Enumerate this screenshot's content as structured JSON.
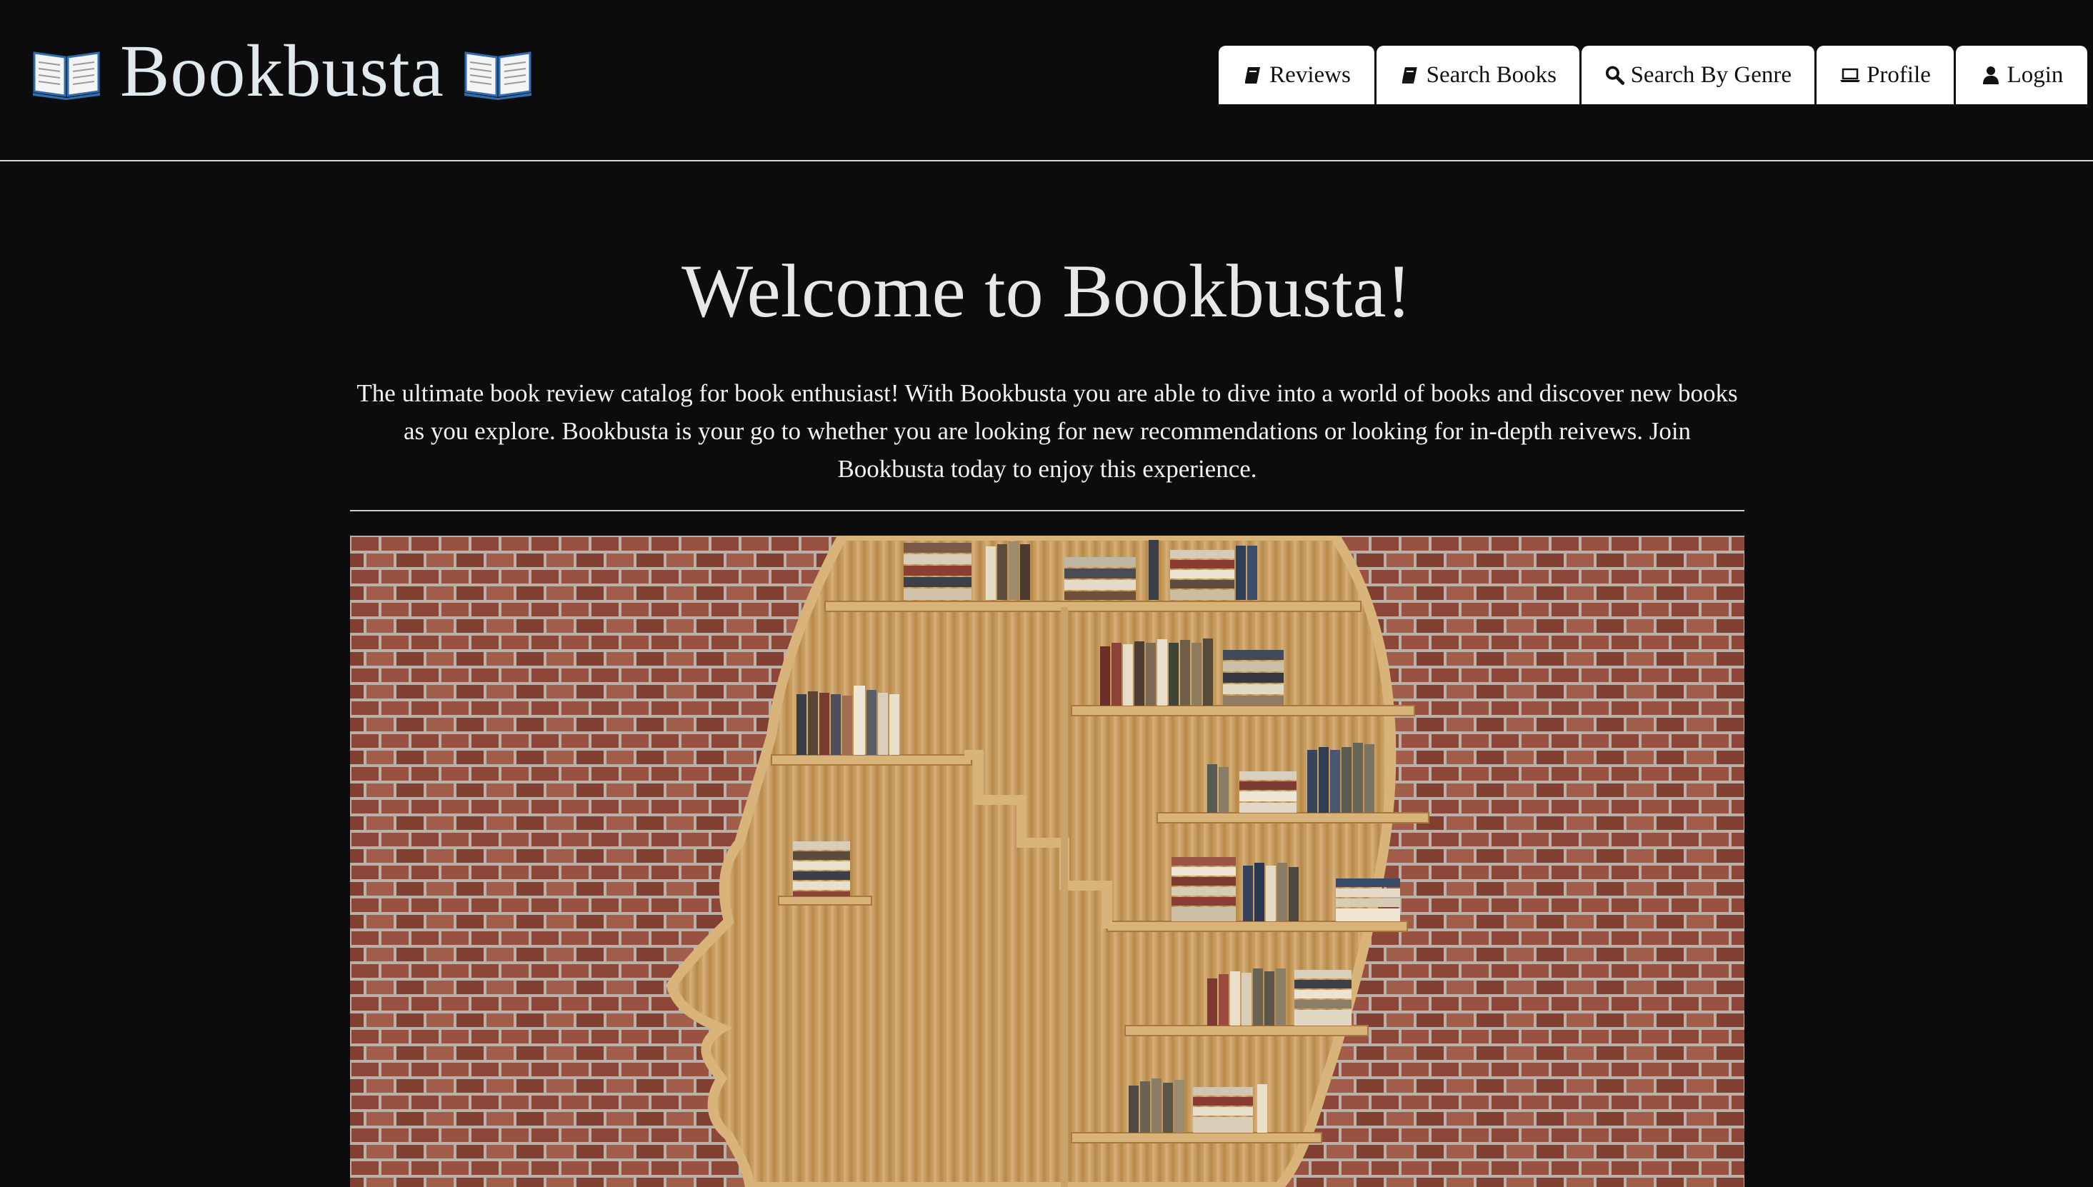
{
  "header": {
    "brand_title": "Bookbusta",
    "brand_icon": "open-book-emoji"
  },
  "nav": {
    "items": [
      {
        "label": "Reviews",
        "icon": "book-icon"
      },
      {
        "label": "Search Books",
        "icon": "book-icon"
      },
      {
        "label": "Search By Genre",
        "icon": "search-icon"
      },
      {
        "label": "Profile",
        "icon": "laptop-icon"
      },
      {
        "label": "Login",
        "icon": "user-icon"
      }
    ]
  },
  "main": {
    "heading": "Welcome to Bookbusta!",
    "intro_lines": [
      "The ultimate book review catalog for book enthusiast! With Bookbusta you are able to dive into a world of books and discover new books",
      "as you explore. Bookbusta is your go to whether you are looking for new recommendations or looking for in-depth reivews. Join",
      "Bookbusta today to enjoy this experience."
    ]
  },
  "hero_image": {
    "subject": "head-shaped-bookshelf-on-brick-wall"
  },
  "colors": {
    "background": "#0c0c0c",
    "nav_button": "#ffffff",
    "heading_text": "#e8e8e8",
    "brick": "#8e4a3c",
    "wood": "#c9a266"
  }
}
